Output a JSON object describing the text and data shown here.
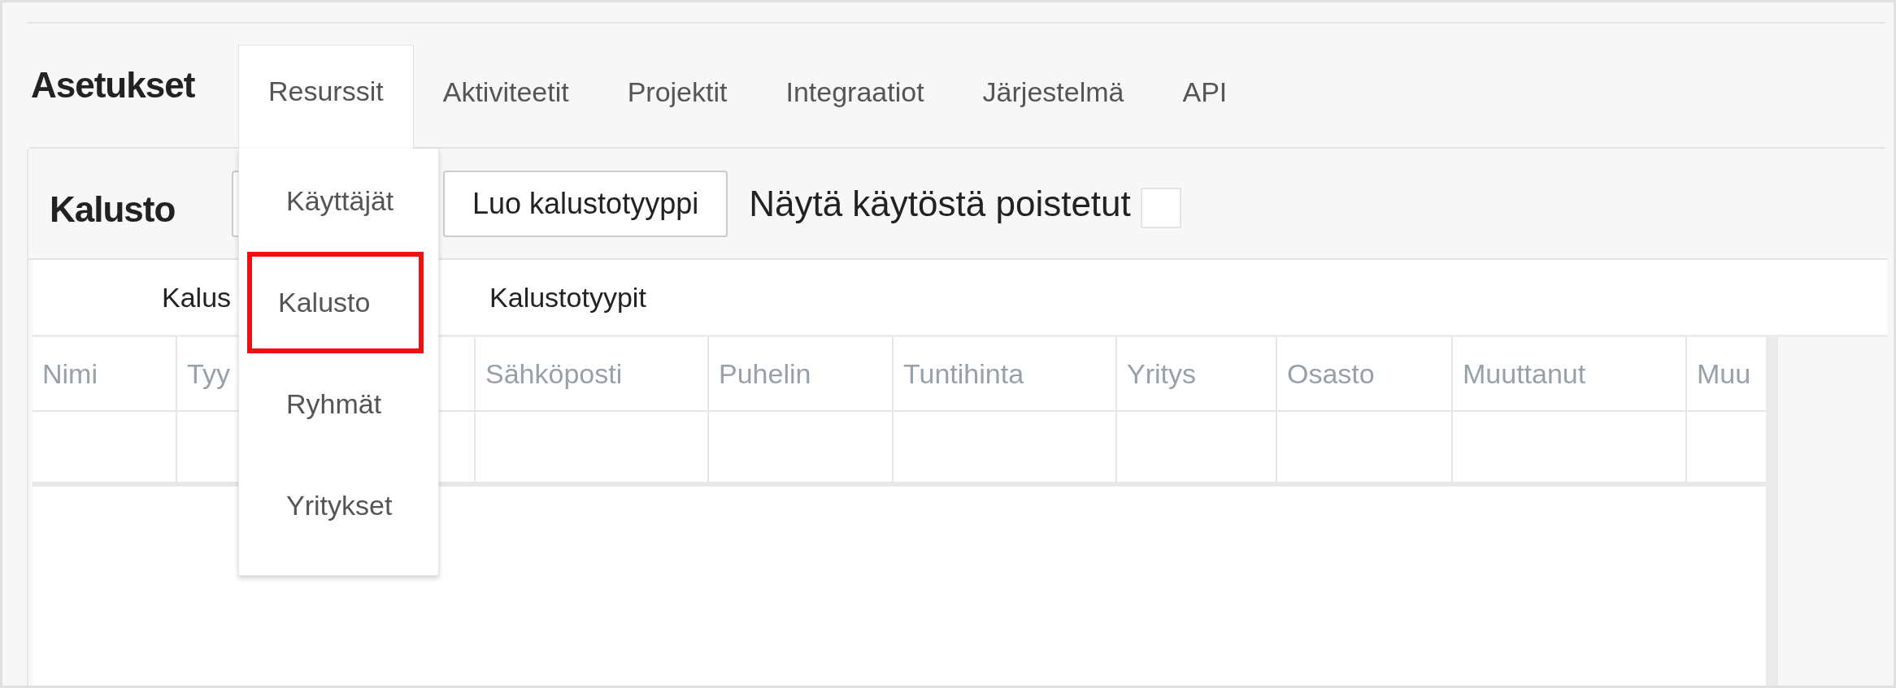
{
  "page_title": "Asetukset",
  "tabs": [
    {
      "label": "Resurssit",
      "selected": true
    },
    {
      "label": "Aktiviteetit",
      "selected": false
    },
    {
      "label": "Projektit",
      "selected": false
    },
    {
      "label": "Integraatiot",
      "selected": false
    },
    {
      "label": "Järjestelmä",
      "selected": false
    },
    {
      "label": "API",
      "selected": false
    }
  ],
  "dropdown": {
    "items": [
      {
        "label": "Käyttäjät",
        "selected": false
      },
      {
        "label": "Kalusto",
        "selected": true
      },
      {
        "label": "Ryhmät",
        "selected": false
      },
      {
        "label": "Yritykset",
        "selected": false
      }
    ]
  },
  "panel": {
    "title": "Kalusto",
    "buttons": [
      "Luo kalustotyyppi"
    ],
    "checkbox": {
      "label": "Näytä käytöstä poistetut",
      "checked": false
    }
  },
  "subtabs": [
    {
      "label": "Kalus"
    },
    {
      "label": "Kalustotyypit"
    }
  ],
  "table": {
    "columns": [
      "Nimi",
      "Tyy",
      "Sähköposti",
      "Puhelin",
      "Tuntihinta",
      "Yritys",
      "Osasto",
      "Muuttanut",
      "Muu"
    ]
  }
}
